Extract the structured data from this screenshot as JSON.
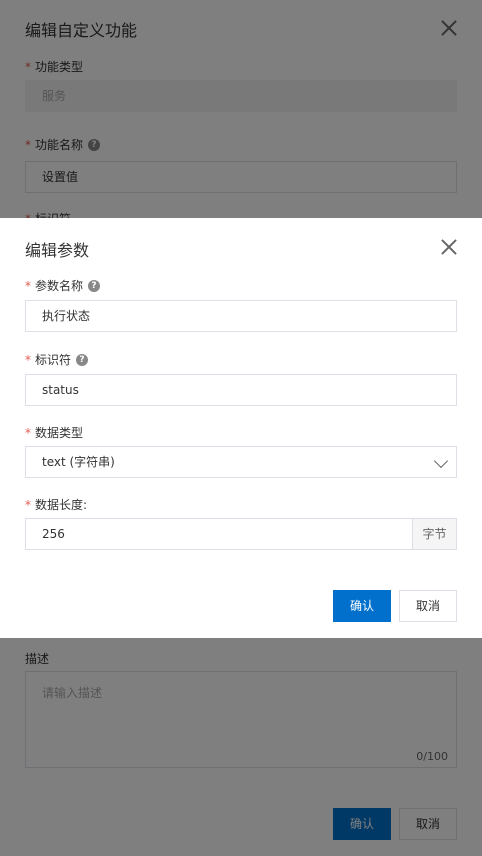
{
  "bg": {
    "title": "编辑自定义功能",
    "function_type_label": "功能类型",
    "function_type_value": "服务",
    "function_name_label": "功能名称",
    "function_name_value": "设置值",
    "identifier_label_partial": "标识符",
    "description_label": "描述",
    "description_placeholder": "请输入描述",
    "description_counter": "0/100",
    "confirm_label": "确认",
    "cancel_label": "取消"
  },
  "modal": {
    "title": "编辑参数",
    "param_name_label": "参数名称",
    "param_name_value": "执行状态",
    "identifier_label": "标识符",
    "identifier_value": "status",
    "data_type_label": "数据类型",
    "data_type_value": "text (字符串)",
    "data_length_label": "数据长度:",
    "data_length_value": "256",
    "data_length_unit": "字节",
    "confirm_label": "确认",
    "cancel_label": "取消"
  },
  "required_mark": "*",
  "help_glyph": "?"
}
